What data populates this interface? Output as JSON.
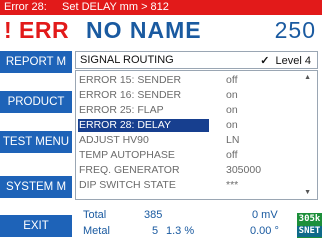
{
  "topbar": {
    "label": "Error 28:",
    "message": "Set DELAY mm > 812"
  },
  "header": {
    "status": "! ERR",
    "title": "NO NAME",
    "value": "250"
  },
  "sidebar": {
    "buttons": [
      {
        "label": "REPORT M"
      },
      {
        "label": "PRODUCT"
      },
      {
        "label": "TEST MENU"
      },
      {
        "label": "SYSTEM M"
      },
      {
        "label": "EXIT"
      }
    ]
  },
  "panel": {
    "title": "SIGNAL ROUTING",
    "checkmark": "✓",
    "level": "Level 4",
    "scroll_up": "▲",
    "scroll_down": "▼",
    "rows": [
      {
        "label": "ERROR 15: SENDER",
        "value": "off",
        "selected": false
      },
      {
        "label": "ERROR 16: SENDER",
        "value": "on",
        "selected": false
      },
      {
        "label": "ERROR 25: FLAP",
        "value": "on",
        "selected": false
      },
      {
        "label": "ERROR 28: DELAY",
        "value": "on",
        "selected": true
      },
      {
        "label": "ADJUST HV90",
        "value": "LN",
        "selected": false
      },
      {
        "label": "TEMP AUTOPHASE",
        "value": "off",
        "selected": false
      },
      {
        "label": "FREQ. GENERATOR",
        "value": "305000",
        "selected": false
      },
      {
        "label": "DIP SWITCH STATE",
        "value": "***",
        "selected": false
      }
    ]
  },
  "footer": {
    "total_label": "Total",
    "total_value": "385",
    "total_unit_value": "0 mV",
    "metal_label": "Metal",
    "metal_value": "5",
    "metal_percent": "1.3 %",
    "metal_angle": "0.00 °"
  },
  "badge": {
    "top": "305k",
    "bottom": "SNET"
  },
  "colors": {
    "error_red": "#e21a1a",
    "button_blue": "#1e63b8",
    "text_blue": "#1a5aa0",
    "selection": "#173f8f",
    "badge_green": "#1c8f3a"
  }
}
